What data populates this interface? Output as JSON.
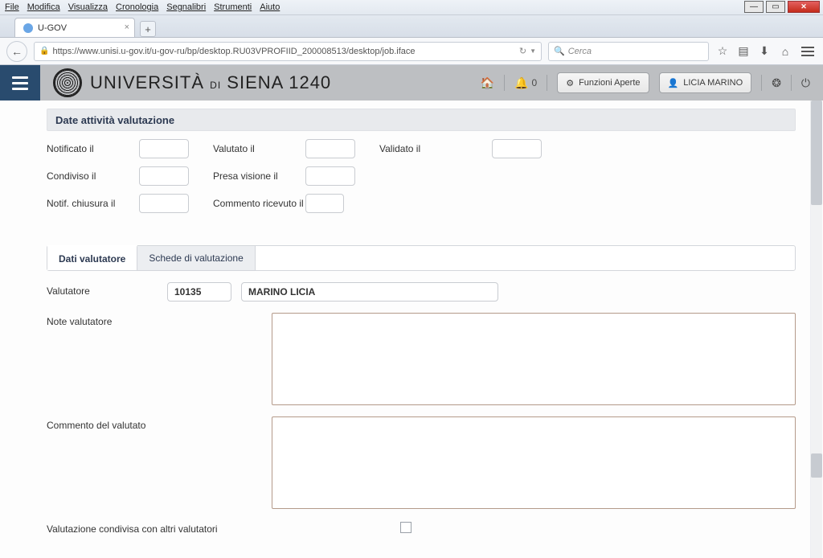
{
  "browser": {
    "menus": {
      "file": "File",
      "edit": "Modifica",
      "view": "Visualizza",
      "history": "Cronologia",
      "bookmarks": "Segnalibri",
      "tools": "Strumenti",
      "help": "Aiuto"
    },
    "tab_title": "U-GOV",
    "url": "https://www.unisi.u-gov.it/u-gov-ru/bp/desktop.RU03VPROFIID_200008513/desktop/job.iface",
    "search_placeholder": "Cerca"
  },
  "header": {
    "university": "UNIVERSITÀ",
    "di": "DI",
    "city": "SIENA",
    "code": "1240",
    "notif_count": "0",
    "funzioni_aperte": "Funzioni Aperte",
    "user_name": "LICIA MARINO"
  },
  "section": {
    "title": "Date attività valutazione",
    "labels": {
      "notificato": "Notificato il",
      "valutato": "Valutato il",
      "validato": "Validato il",
      "condiviso": "Condiviso il",
      "presa_visione": "Presa visione il",
      "notif_chiusura": "Notif. chiusura il",
      "commento_ricevuto": "Commento ricevuto il"
    },
    "values": {
      "notificato": "",
      "valutato": "",
      "validato": "",
      "condiviso": "",
      "presa_visione": "",
      "notif_chiusura": "",
      "commento_ricevuto": ""
    }
  },
  "tabs": {
    "dati_valutatore": "Dati valutatore",
    "schede": "Schede di valutazione"
  },
  "form": {
    "valutatore_label": "Valutatore",
    "valutatore_code": "10135",
    "valutatore_name": "MARINO LICIA",
    "note_label": "Note valutatore",
    "note_value": "",
    "commento_label": "Commento del valutato",
    "commento_value": "",
    "condivisa_label": "Valutazione condivisa con altri valutatori",
    "condivisa_checked": false
  }
}
